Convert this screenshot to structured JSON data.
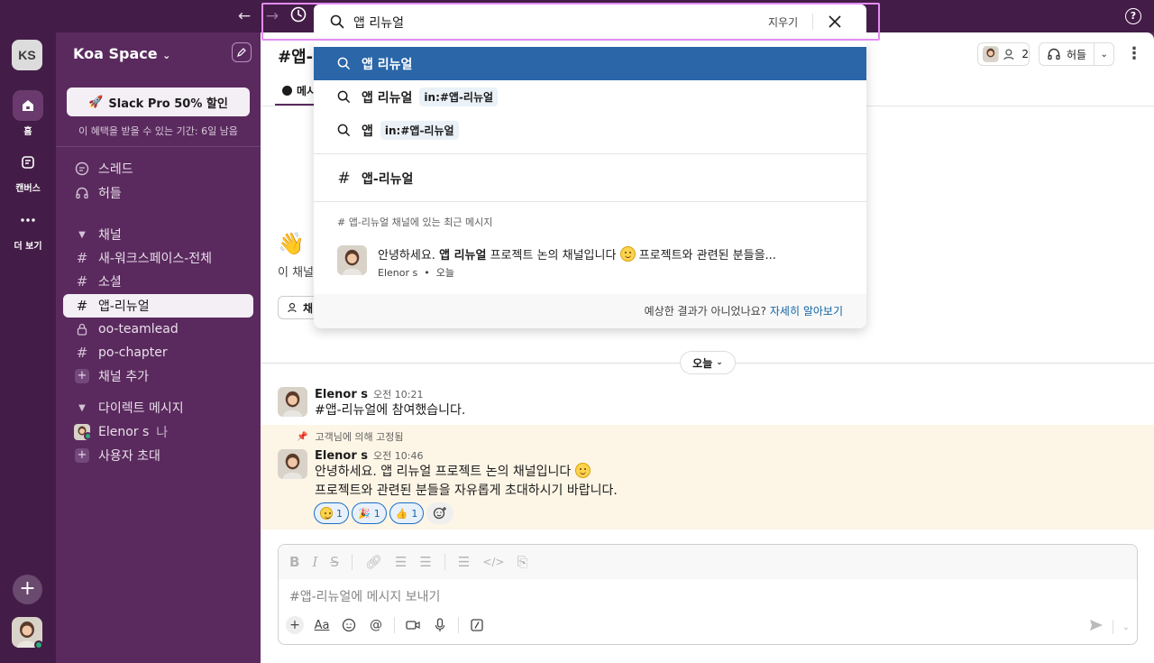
{
  "topbar": {
    "help_label": "?"
  },
  "rail": {
    "workspace_initials": "KS",
    "items": [
      {
        "label": "홈",
        "icon": "home-icon"
      },
      {
        "label": "캔버스",
        "icon": "canvas-icon"
      },
      {
        "label": "더 보기",
        "icon": "more-icon"
      }
    ]
  },
  "sidebar": {
    "workspace_name": "Koa Space",
    "promo_label": "Slack Pro 50% 할인",
    "promo_note": "이 혜택을 받을 수 있는 기간: 6일 남음",
    "top_items": [
      "스레드",
      "허들"
    ],
    "channels_header": "채널",
    "channels": [
      "새-워크스페이스-전체",
      "소셜",
      "앱-리뉴얼",
      "oo-teamlead",
      "po-chapter"
    ],
    "add_channel": "채널 추가",
    "dm_header": "다이렉트 메시지",
    "dm_user": "Elenor s",
    "dm_user_suffix": "나",
    "invite": "사용자 초대"
  },
  "channel": {
    "title": "#앱-",
    "member_count": "2",
    "huddle_label": "허들",
    "tab_messages": "메시",
    "intro_text": "이 채널",
    "intro_button": "채",
    "date_pill": "오늘"
  },
  "messages": [
    {
      "author": "Elenor s",
      "time": "오전 10:21",
      "text": "#앱-리뉴얼에 참여했습니다."
    },
    {
      "pinned_note": "고객님에 의해 고정됨",
      "author": "Elenor s",
      "time": "오전 10:46",
      "text_line1": "안녕하세요. 앱 리뉴얼 프로젝트 논의 채널입니다",
      "text_line2": "프로젝트와 관련된 분들을 자유롭게 초대하시기 바랍니다.",
      "reactions": [
        {
          "emoji": "slightly-smiling",
          "count": "1"
        },
        {
          "emoji": "party-popper",
          "count": "1"
        },
        {
          "emoji": "thumbs-up",
          "count": "1"
        }
      ]
    }
  ],
  "composer": {
    "placeholder": "#앱-리뉴얼에 메시지 보내기"
  },
  "search": {
    "query": "앱 리뉴얼",
    "clear_label": "지우기",
    "suggestions": [
      {
        "text": "앱 리뉴얼",
        "chip": ""
      },
      {
        "text": "앱 리뉴얼",
        "chip": "in:#앱-리뉴얼"
      },
      {
        "text": "앱",
        "chip": "in:#앱-리뉴얼"
      }
    ],
    "channel_result": "앱-리뉴얼",
    "recent_header": "# 앱-리뉴얼 채널에 있는 최근 메시지",
    "recent_message": {
      "pre": "안녕하세요.",
      "bold": "앱 리뉴얼",
      "mid": "프로젝트 논의 채널입니다",
      "post": "프로젝트와 관련된 분들을...",
      "author": "Elenor s",
      "time": "오늘"
    },
    "footer_text": "예상한 결과가 아니었나요?",
    "footer_link": "자세히 알아보기"
  }
}
